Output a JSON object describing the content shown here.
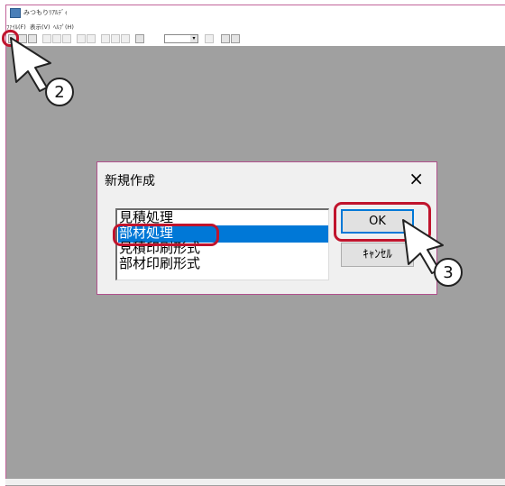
{
  "window": {
    "title": "みつもりﾘｱﾙﾃﾞｨ"
  },
  "menu": [
    {
      "label": "ﾌｧｲﾙ(F)"
    },
    {
      "label": "表示(V)"
    },
    {
      "label": "ﾍﾙﾌﾟ(H)"
    }
  ],
  "dialog": {
    "title": "新規作成",
    "close_glyph": "×",
    "items": [
      {
        "label": "見積処理",
        "selected": false
      },
      {
        "label": "部材処理",
        "selected": true
      },
      {
        "label": "見積印刷形式",
        "selected": false
      },
      {
        "label": "部材印刷形式",
        "selected": false
      }
    ],
    "ok_label": "OK",
    "cancel_label": "ｷｬﾝｾﾙ"
  },
  "annotations": {
    "step2": "2",
    "step3": "3",
    "highlight_color": "#c0142d"
  },
  "colors": {
    "workspace": "#a0a0a0",
    "selection": "#0078d7"
  }
}
